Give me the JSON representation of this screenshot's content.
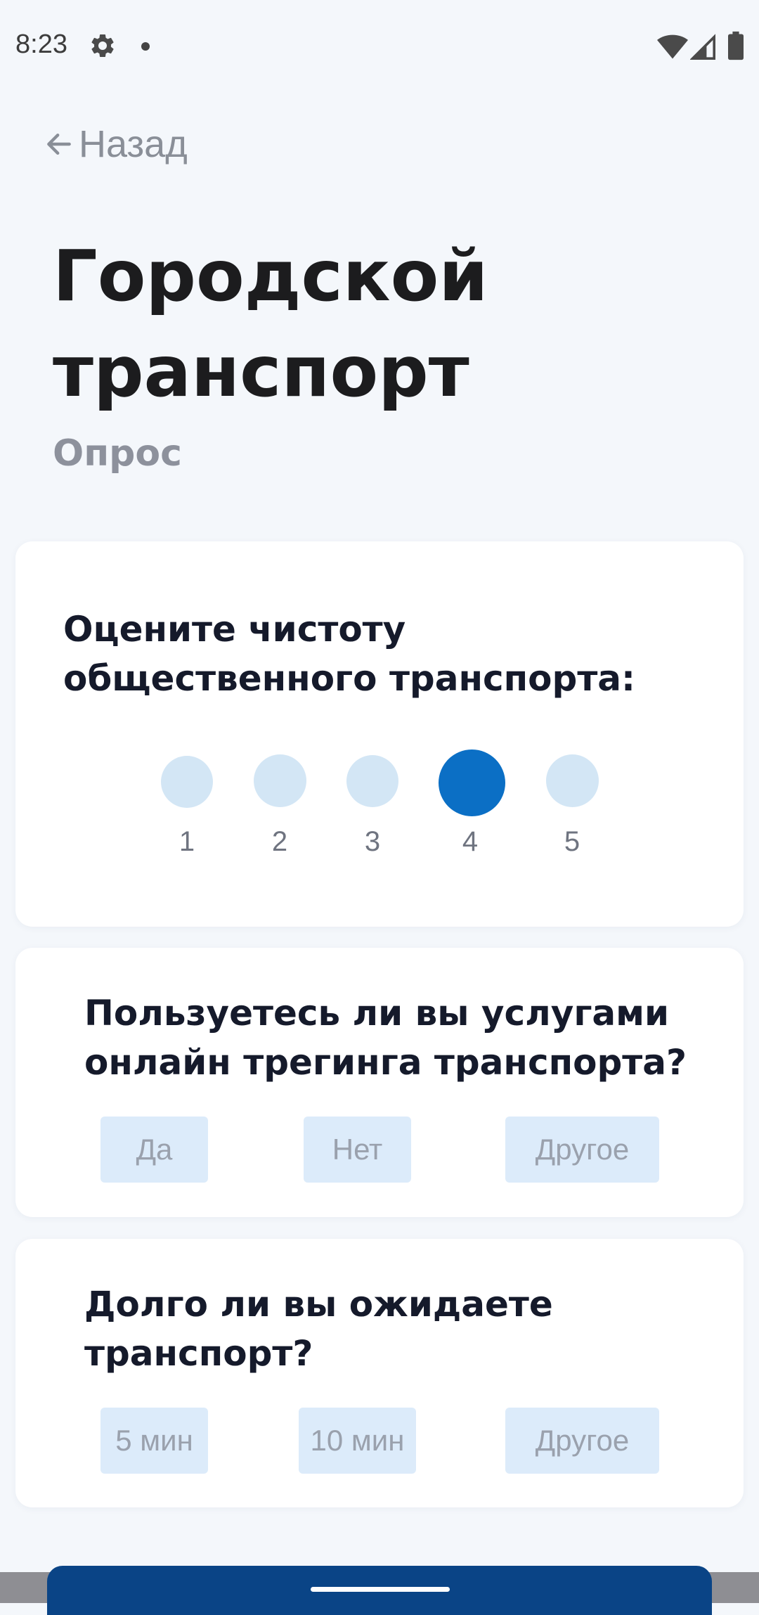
{
  "status_bar": {
    "time": "8:23",
    "icons": [
      "settings-icon",
      "notification-dot-icon",
      "wifi-icon",
      "signal-icon",
      "battery-icon"
    ]
  },
  "nav": {
    "back_label": "Назад"
  },
  "header": {
    "title_line1": "Городской",
    "title_line2": "транспорт",
    "subtitle": "Опрос"
  },
  "questions": [
    {
      "text": "Оцените чистоту общественного транспорта:",
      "type": "rating",
      "options": [
        "1",
        "2",
        "3",
        "4",
        "5"
      ],
      "selected": "4"
    },
    {
      "text": "Пользуетесь ли вы услугами онлайн трегинга транспорта?",
      "type": "choice",
      "options": [
        "Да",
        "Нет",
        "Другое"
      ]
    },
    {
      "text": "Долго ли вы ожидаете транспорт?",
      "type": "choice",
      "options": [
        "5 мин",
        "10 мин",
        "Другое"
      ]
    }
  ],
  "colors": {
    "accent": "#0b6fc5",
    "rating_inactive": "#d3e6f5",
    "option_bg": "#dcebfa",
    "cta_bg": "#0a4486",
    "background": "#f4f7fb"
  }
}
